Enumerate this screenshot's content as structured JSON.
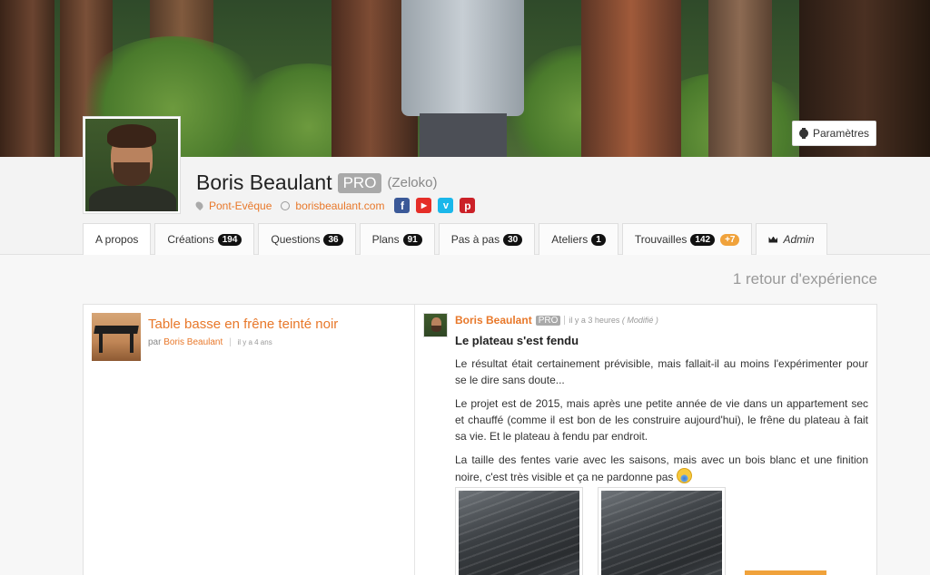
{
  "header": {
    "settings_label": "Paramètres",
    "name": "Boris Beaulant",
    "pro_badge": "PRO",
    "pseudo": "(Zeloko)",
    "location": "Pont-Evêque",
    "website": "borisbeaulant.com",
    "socials": [
      "facebook-icon",
      "youtube-icon",
      "vimeo-icon",
      "pinterest-icon"
    ]
  },
  "tabs": [
    {
      "label": "A propos"
    },
    {
      "label": "Créations",
      "count": "194"
    },
    {
      "label": "Questions",
      "count": "36"
    },
    {
      "label": "Plans",
      "count": "91"
    },
    {
      "label": "Pas à pas",
      "count": "30"
    },
    {
      "label": "Ateliers",
      "count": "1"
    },
    {
      "label": "Trouvailles",
      "count": "142",
      "extra": "+7"
    },
    {
      "label": "Admin"
    }
  ],
  "main": {
    "retour_count": "1 retour d'expérience",
    "project": {
      "title": "Table basse en frêne teinté noir",
      "by_prefix": "par",
      "author": "Boris Beaulant",
      "time": "il y a 4 ans"
    },
    "post": {
      "author": "Boris Beaulant",
      "pro": "PRO",
      "time": "il y a 3 heures",
      "modified": "( Modifié )",
      "title": "Le plateau s'est fendu",
      "p1": "Le résultat était certainement prévisible, mais fallait-il au moins l'expérimenter pour se le dire sans doute...",
      "p2": "Le projet est de 2015, mais après une petite année de vie dans un appartement sec et chauffé (comme il est bon de les construire aujourd'hui), le frêne du plateau à fait sa vie. Et le plateau à fendu par endroit.",
      "p3": "La taille des fentes varie avec les saisons, mais avec un bois blanc et une finition noire, c'est très visible et ça ne pardonne pas"
    }
  },
  "colors": {
    "accent": "#e8782a",
    "badge": "#a9a9a9",
    "count_bg": "#111111",
    "extra_count_bg": "#f0a23b"
  }
}
